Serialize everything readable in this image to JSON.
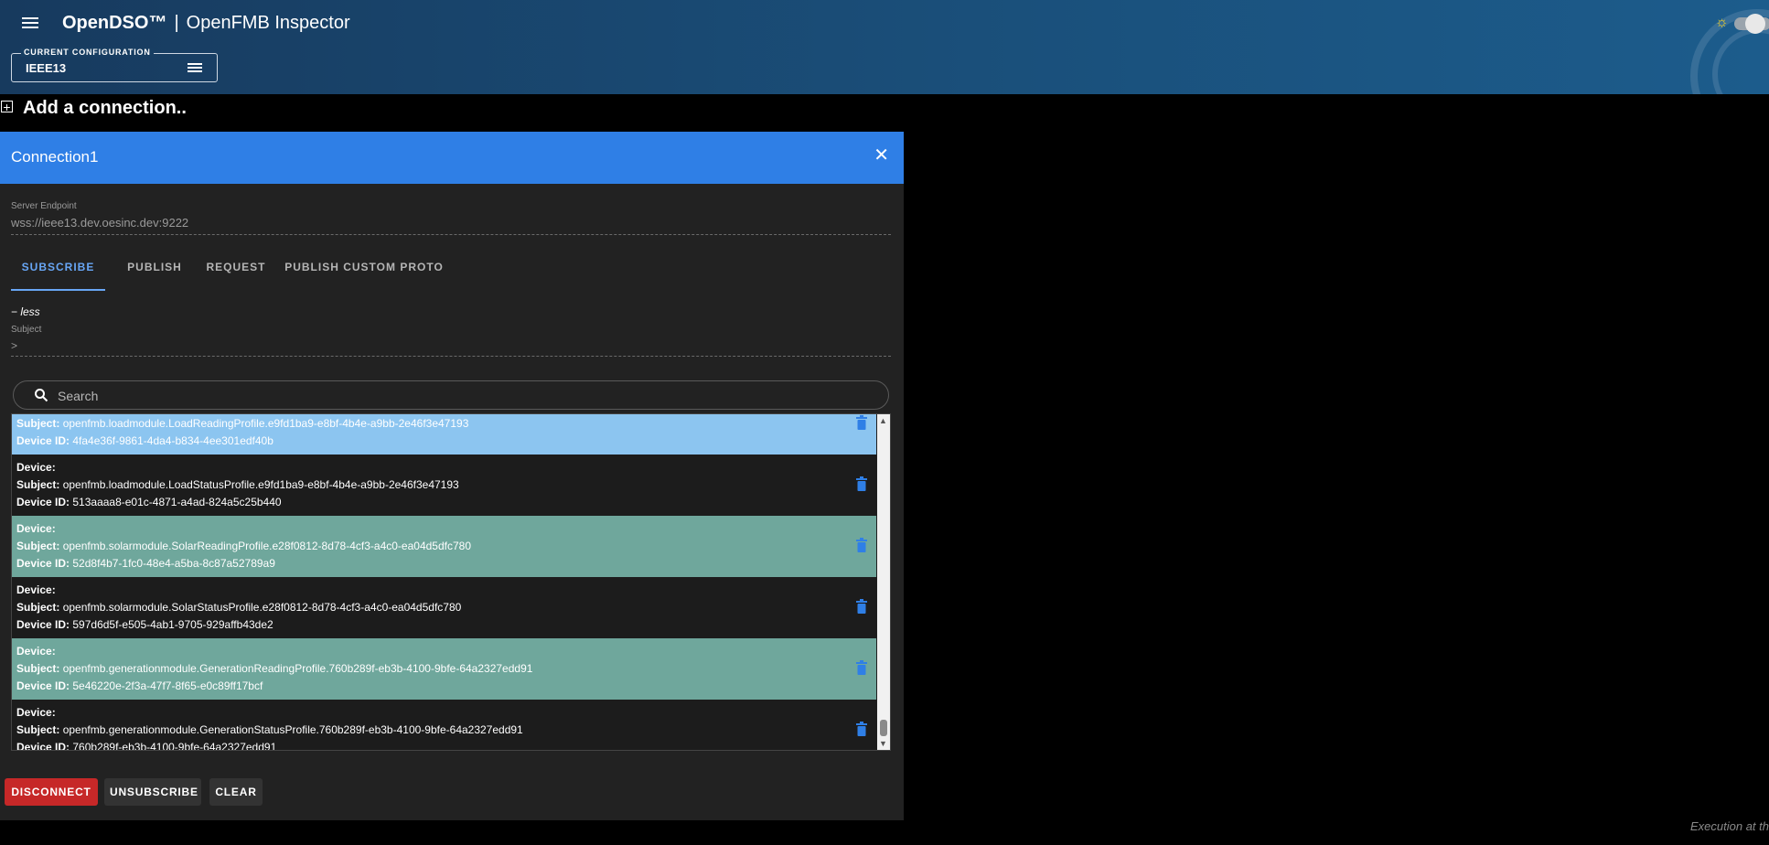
{
  "header": {
    "brand": "OpenDSO™",
    "separator": "|",
    "app_name": "OpenFMB Inspector",
    "config_label": "CURRENT CONFIGURATION",
    "config_value": "IEEE13"
  },
  "add_connection_label": "Add a connection..",
  "connection": {
    "title": "Connection1",
    "close_icon": "✕",
    "endpoint_label": "Server Endpoint",
    "endpoint_value": "wss://ieee13.dev.oesinc.dev:9222",
    "tabs": [
      {
        "label": "SUBSCRIBE",
        "active": true
      },
      {
        "label": "PUBLISH",
        "active": false
      },
      {
        "label": "REQUEST",
        "active": false
      },
      {
        "label": "PUBLISH CUSTOM PROTO",
        "active": false
      }
    ],
    "less_link": "− less",
    "subject_label": "Subject",
    "subject_value": ">",
    "search_placeholder": "Search",
    "field_labels": {
      "device": "Device:",
      "subject": "Subject:",
      "device_id": "Device ID:"
    },
    "rows": [
      {
        "device": "",
        "subject": "openfmb.loadmodule.LoadReadingProfile.e9fd1ba9-e8bf-4b4e-a9bb-2e46f3e47193",
        "device_id": "4fa4e36f-9861-4da4-b834-4ee301edf40b",
        "color": "blue"
      },
      {
        "device": "",
        "subject": "openfmb.loadmodule.LoadStatusProfile.e9fd1ba9-e8bf-4b4e-a9bb-2e46f3e47193",
        "device_id": "513aaaa8-e01c-4871-a4ad-824a5c25b440",
        "color": "dark"
      },
      {
        "device": "",
        "subject": "openfmb.solarmodule.SolarReadingProfile.e28f0812-8d78-4cf3-a4c0-ea04d5dfc780",
        "device_id": "52d8f4b7-1fc0-48e4-a5ba-8c87a52789a9",
        "color": "teal"
      },
      {
        "device": "",
        "subject": "openfmb.solarmodule.SolarStatusProfile.e28f0812-8d78-4cf3-a4c0-ea04d5dfc780",
        "device_id": "597d6d5f-e505-4ab1-9705-929affb43de2",
        "color": "dark"
      },
      {
        "device": "",
        "subject": "openfmb.generationmodule.GenerationReadingProfile.760b289f-eb3b-4100-9bfe-64a2327edd91",
        "device_id": "5e46220e-2f3a-47f7-8f65-e0c89ff17bcf",
        "color": "teal"
      },
      {
        "device": "",
        "subject": "openfmb.generationmodule.GenerationStatusProfile.760b289f-eb3b-4100-9bfe-64a2327edd91",
        "device_id": "760b289f-eb3b-4100-9bfe-64a2327edd91",
        "color": "dark"
      }
    ],
    "buttons": {
      "disconnect": "DISCONNECT",
      "unsubscribe": "UNSUBSCRIBE",
      "clear": "CLEAR"
    }
  },
  "footer_text": "Execution at th",
  "colors": {
    "accent": "#2f7fe6",
    "tab_active": "#68a6f5",
    "danger": "#c62828",
    "row_blue": "#8cc5f0",
    "row_teal": "#6fa79c",
    "trash": "#2f7fe6"
  },
  "icons": {
    "menu": "menu-icon",
    "config_menu": "list-icon",
    "theme": "sun-icon",
    "add": "plus-square-icon",
    "close": "close-icon",
    "search": "search-icon",
    "delete": "trash-icon"
  }
}
